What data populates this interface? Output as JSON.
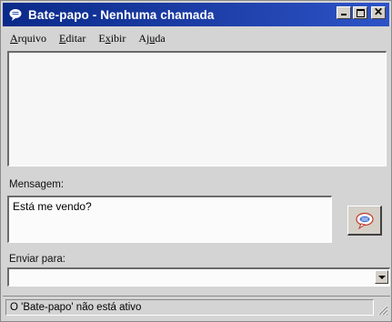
{
  "window": {
    "title": "Bate-papo - Nenhuma chamada",
    "title_bar_color": "#1e3fa8"
  },
  "menu": {
    "items": [
      {
        "mnemonic": "A",
        "rest": "rquivo"
      },
      {
        "mnemonic": "E",
        "rest": "ditar"
      },
      {
        "pre": "E",
        "mnemonic": "x",
        "rest": "ibir"
      },
      {
        "pre": "Aj",
        "mnemonic": "u",
        "rest": "da"
      }
    ]
  },
  "chat": {
    "history": ""
  },
  "message": {
    "label": "Mensagem:",
    "value": "Está me vendo?"
  },
  "send": {
    "icon": "chat-bubble-icon"
  },
  "recipient": {
    "label": "Enviar para:",
    "value": ""
  },
  "status": {
    "text": "O 'Bate-papo' não está ativo"
  }
}
